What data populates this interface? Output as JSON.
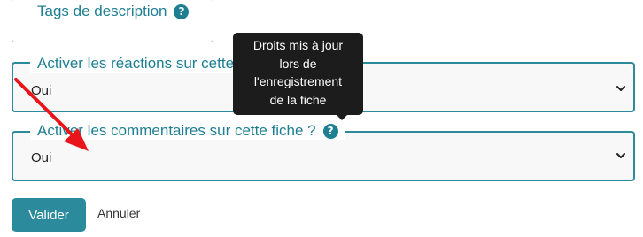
{
  "form": {
    "tags": {
      "label": "Tags de description",
      "value": ""
    },
    "reactions": {
      "label": "Activer les réactions sur cette fiche",
      "selected": "Oui"
    },
    "comments": {
      "label": "Activer les commentaires sur cette fiche ?",
      "selected": "Oui"
    },
    "help_icon_glyph": "?",
    "tooltip": {
      "lines": [
        "Droits mis à jour",
        "lors de",
        "l'enregistrement",
        "de la fiche"
      ]
    },
    "buttons": {
      "validate": "Valider",
      "cancel": "Annuler"
    }
  },
  "colors": {
    "accent": "#2b8a9c",
    "label": "#1d7f91",
    "tooltip_bg": "#1c1c1c",
    "annotation_arrow": "#e8161b"
  }
}
